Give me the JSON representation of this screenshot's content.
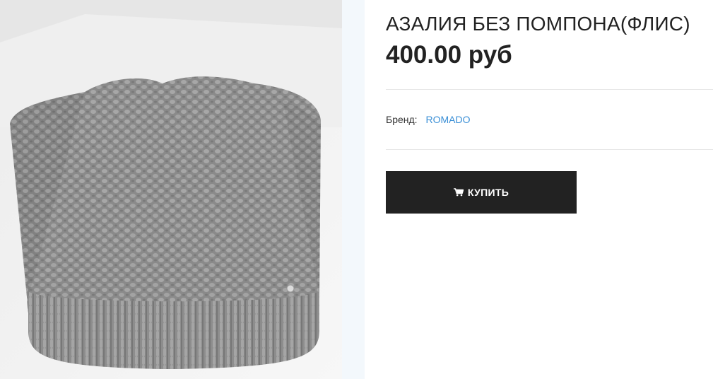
{
  "product": {
    "image_alt": "АЗАЛИЯ БЕЗ ПОМПОНА(ФЛИС)",
    "title": "АЗАЛИЯ БЕЗ ПОМПОНА(ФЛИС)",
    "price": "400.00 руб",
    "brand_label": "Бренд:",
    "brand_value": "ROMADO",
    "buy_label": "КУПИТЬ",
    "buy_icon": "shopping-cart-icon"
  },
  "colors": {
    "accent_link": "#3a8fd6",
    "button_bg": "#222222",
    "knit_gray": "#8e8e8e"
  }
}
